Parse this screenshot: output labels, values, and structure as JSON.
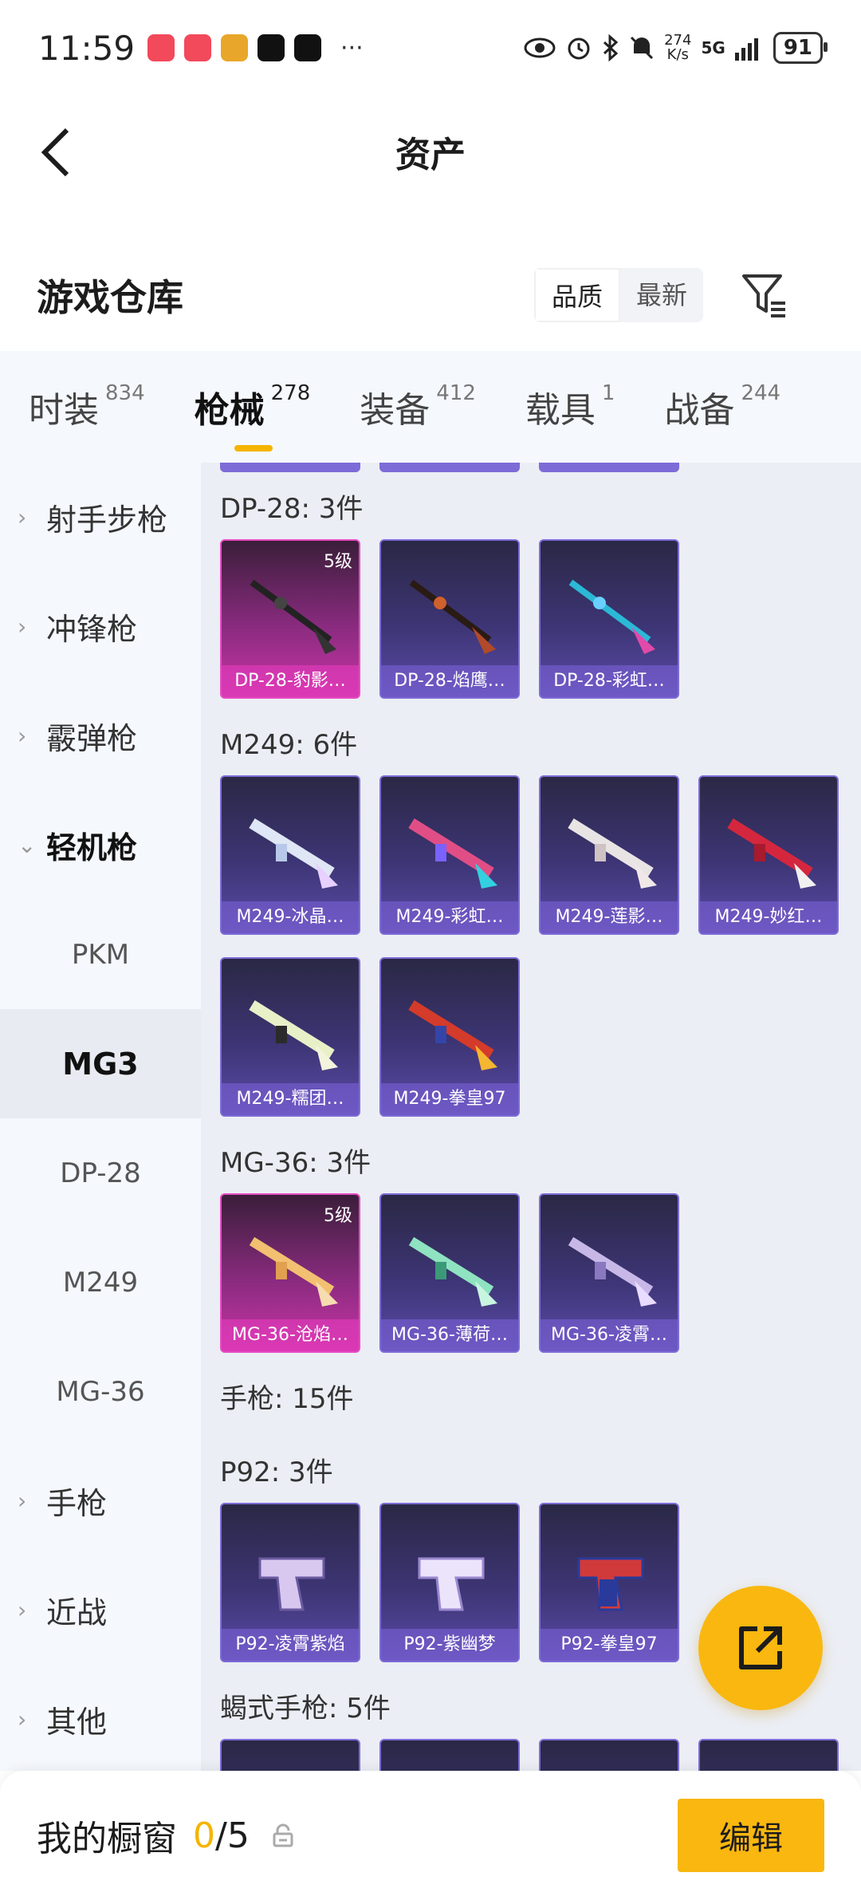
{
  "status_bar": {
    "time": "11:59",
    "more": "···",
    "netspeed_value": "274",
    "netspeed_unit": "K/s",
    "network": "5G",
    "battery": "91"
  },
  "nav": {
    "title": "资产"
  },
  "warehouse": {
    "title": "游戏仓库",
    "sort_options": [
      "品质",
      "最新"
    ],
    "active_sort": "品质"
  },
  "category_tabs": [
    {
      "label": "时装",
      "count": "834"
    },
    {
      "label": "枪械",
      "count": "278"
    },
    {
      "label": "装备",
      "count": "412"
    },
    {
      "label": "载具",
      "count": "1"
    },
    {
      "label": "战备",
      "count": "244"
    }
  ],
  "active_category": "枪械",
  "sidebar": {
    "items": [
      {
        "label": "射手步枪"
      },
      {
        "label": "冲锋枪"
      },
      {
        "label": "霰弹枪"
      },
      {
        "label": "轻机枪"
      }
    ],
    "subitems": [
      {
        "label": "PKM"
      },
      {
        "label": "MG3"
      },
      {
        "label": "DP-28"
      },
      {
        "label": "M249"
      },
      {
        "label": "MG-36"
      }
    ],
    "items_after": [
      {
        "label": "手枪"
      },
      {
        "label": "近战"
      },
      {
        "label": "其他"
      }
    ],
    "active_sub": "MG3"
  },
  "groups": {
    "dp28": {
      "title": "DP-28: 3件",
      "items": [
        {
          "label": "DP-28-豹影…",
          "level": "5级"
        },
        {
          "label": "DP-28-焰鹰…"
        },
        {
          "label": "DP-28-彩虹…"
        }
      ]
    },
    "m249": {
      "title": "M249: 6件",
      "items": [
        {
          "label": "M249-冰晶…"
        },
        {
          "label": "M249-彩虹…"
        },
        {
          "label": "M249-莲影…"
        },
        {
          "label": "M249-妙红…"
        },
        {
          "label": "M249-糯团…"
        },
        {
          "label": "M249-拳皇97"
        }
      ]
    },
    "mg36": {
      "title": "MG-36: 3件",
      "items": [
        {
          "label": "MG-36-沧焰…",
          "level": "5级"
        },
        {
          "label": "MG-36-薄荷…"
        },
        {
          "label": "MG-36-凌霄…"
        }
      ]
    },
    "pistol_header": "手枪: 15件",
    "p92": {
      "title": "P92: 3件",
      "items": [
        {
          "label": "P92-凌霄紫焰"
        },
        {
          "label": "P92-紫幽梦"
        },
        {
          "label": "P92-拳皇97"
        }
      ]
    },
    "scorpion": {
      "title": "蝎式手枪: 5件"
    }
  },
  "bottom_bar": {
    "title": "我的橱窗",
    "current": "0",
    "total": "/5",
    "edit_label": "编辑"
  },
  "colors": {
    "accent": "#f9b70f",
    "card_purple": "#5b4ba8",
    "card_pink": "#c935a6"
  }
}
